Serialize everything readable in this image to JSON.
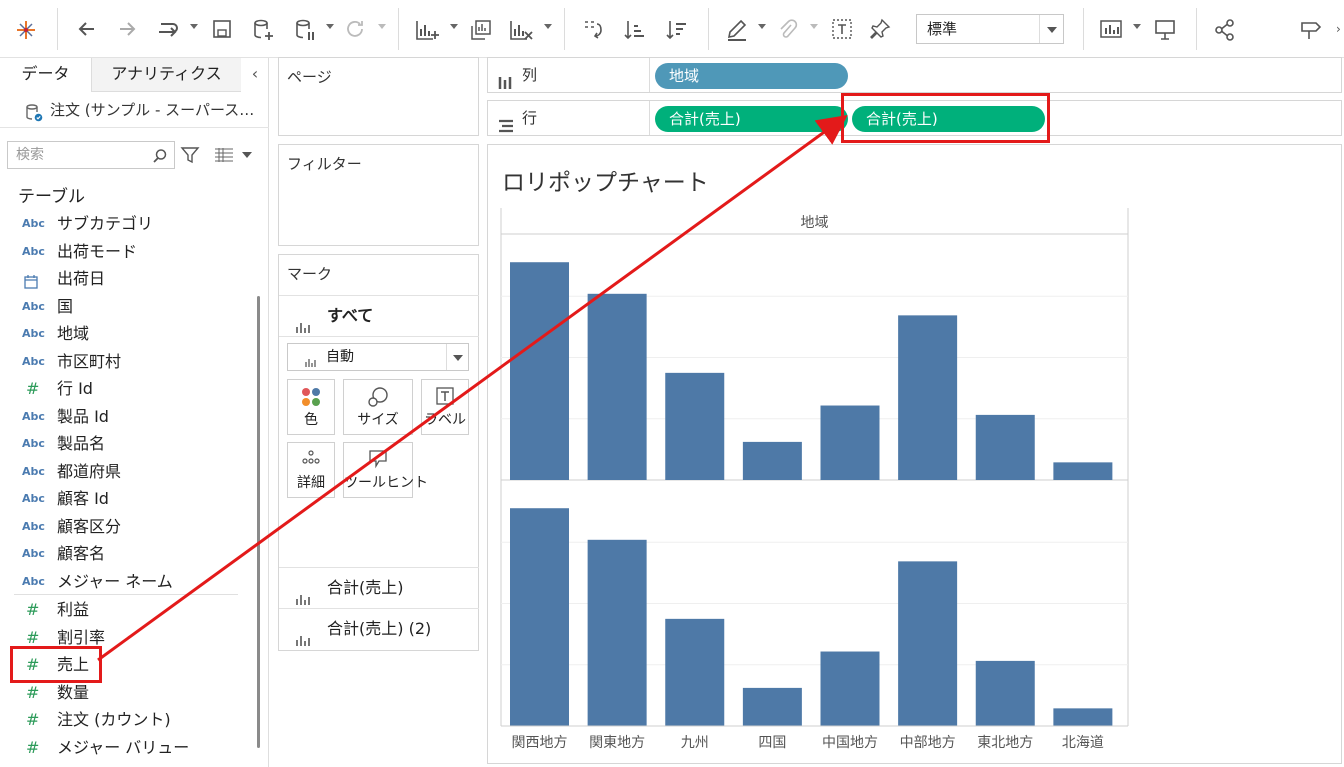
{
  "toolbar": {
    "icons": [
      "tableau-logo-icon",
      "undo-icon",
      "redo-icon",
      "replay-icon",
      "save-icon",
      "new-datasource-icon",
      "pause-updates-icon",
      "refresh-icon",
      "new-worksheet-icon",
      "duplicate-icon",
      "clear-sheet-icon",
      "swap-icon",
      "sort-ascending-icon",
      "sort-descending-icon",
      "highlight-icon",
      "group-icon",
      "label-icon",
      "pin-icon",
      "show-me-icon",
      "presentation-icon",
      "share-icon",
      "show-hide-cards-icon"
    ],
    "fit_select": "標準"
  },
  "data_pane": {
    "tabs": [
      "データ",
      "アナリティクス"
    ],
    "datasource": "注文 (サンプル - スーパース…",
    "search_placeholder": "検索",
    "section_title": "テーブル",
    "dimensions": [
      {
        "type": "Abc",
        "label": "サブカテゴリ"
      },
      {
        "type": "Abc",
        "label": "出荷モード"
      },
      {
        "type": "date",
        "label": "出荷日"
      },
      {
        "type": "Abc",
        "label": "国"
      },
      {
        "type": "Abc",
        "label": "地域"
      },
      {
        "type": "Abc",
        "label": "市区町村"
      },
      {
        "type": "#",
        "label": "行 Id"
      },
      {
        "type": "Abc",
        "label": "製品 Id"
      },
      {
        "type": "Abc",
        "label": "製品名"
      },
      {
        "type": "Abc",
        "label": "都道府県"
      },
      {
        "type": "Abc",
        "label": "顧客 Id"
      },
      {
        "type": "Abc",
        "label": "顧客区分"
      },
      {
        "type": "Abc",
        "label": "顧客名"
      },
      {
        "type": "Abc",
        "label": "メジャー ネーム"
      }
    ],
    "measures": [
      {
        "type": "#",
        "label": "利益"
      },
      {
        "type": "#",
        "label": "割引率"
      },
      {
        "type": "#",
        "label": "売上"
      },
      {
        "type": "#",
        "label": "数量"
      },
      {
        "type": "#",
        "label": "注文 (カウント)"
      },
      {
        "type": "#",
        "label": "メジャー バリュー"
      }
    ]
  },
  "shelves": {
    "pages_title": "ページ",
    "filters_title": "フィルター",
    "marks_title": "マーク",
    "marks_all": "すべて",
    "mark_type": "自動",
    "mark_buttons": [
      "色",
      "サイズ",
      "ラベル",
      "詳細",
      "ツールヒント"
    ],
    "marks_measures": [
      "合計(売上)",
      "合計(売上) (2)"
    ],
    "columns_label": "列",
    "columns_pills": [
      "地域"
    ],
    "rows_label": "行",
    "rows_pills": [
      "合計(売上)",
      "合計(売上)"
    ]
  },
  "view": {
    "title": "ロリポップチャート"
  },
  "chart_data": {
    "type": "bar",
    "header": "地域",
    "categories": [
      "関西地方",
      "関東地方",
      "九州",
      "四国",
      "中国地方",
      "中部地方",
      "東北地方",
      "北海道"
    ],
    "series": [
      {
        "values": [
          100,
          85.5,
          49.2,
          17.5,
          34.2,
          75.6,
          29.9,
          8.1
        ]
      },
      {
        "values": [
          100,
          85.5,
          49.2,
          17.5,
          34.2,
          75.6,
          29.9,
          8.1
        ]
      }
    ],
    "ylim": [
      0,
      112.5
    ],
    "grid": true,
    "axis_visible": false,
    "color": "#4e79a7"
  },
  "annotation": {
    "color": "#e31a1a",
    "arrows": [
      "drag-from-measure-to-rows-shelf"
    ]
  }
}
